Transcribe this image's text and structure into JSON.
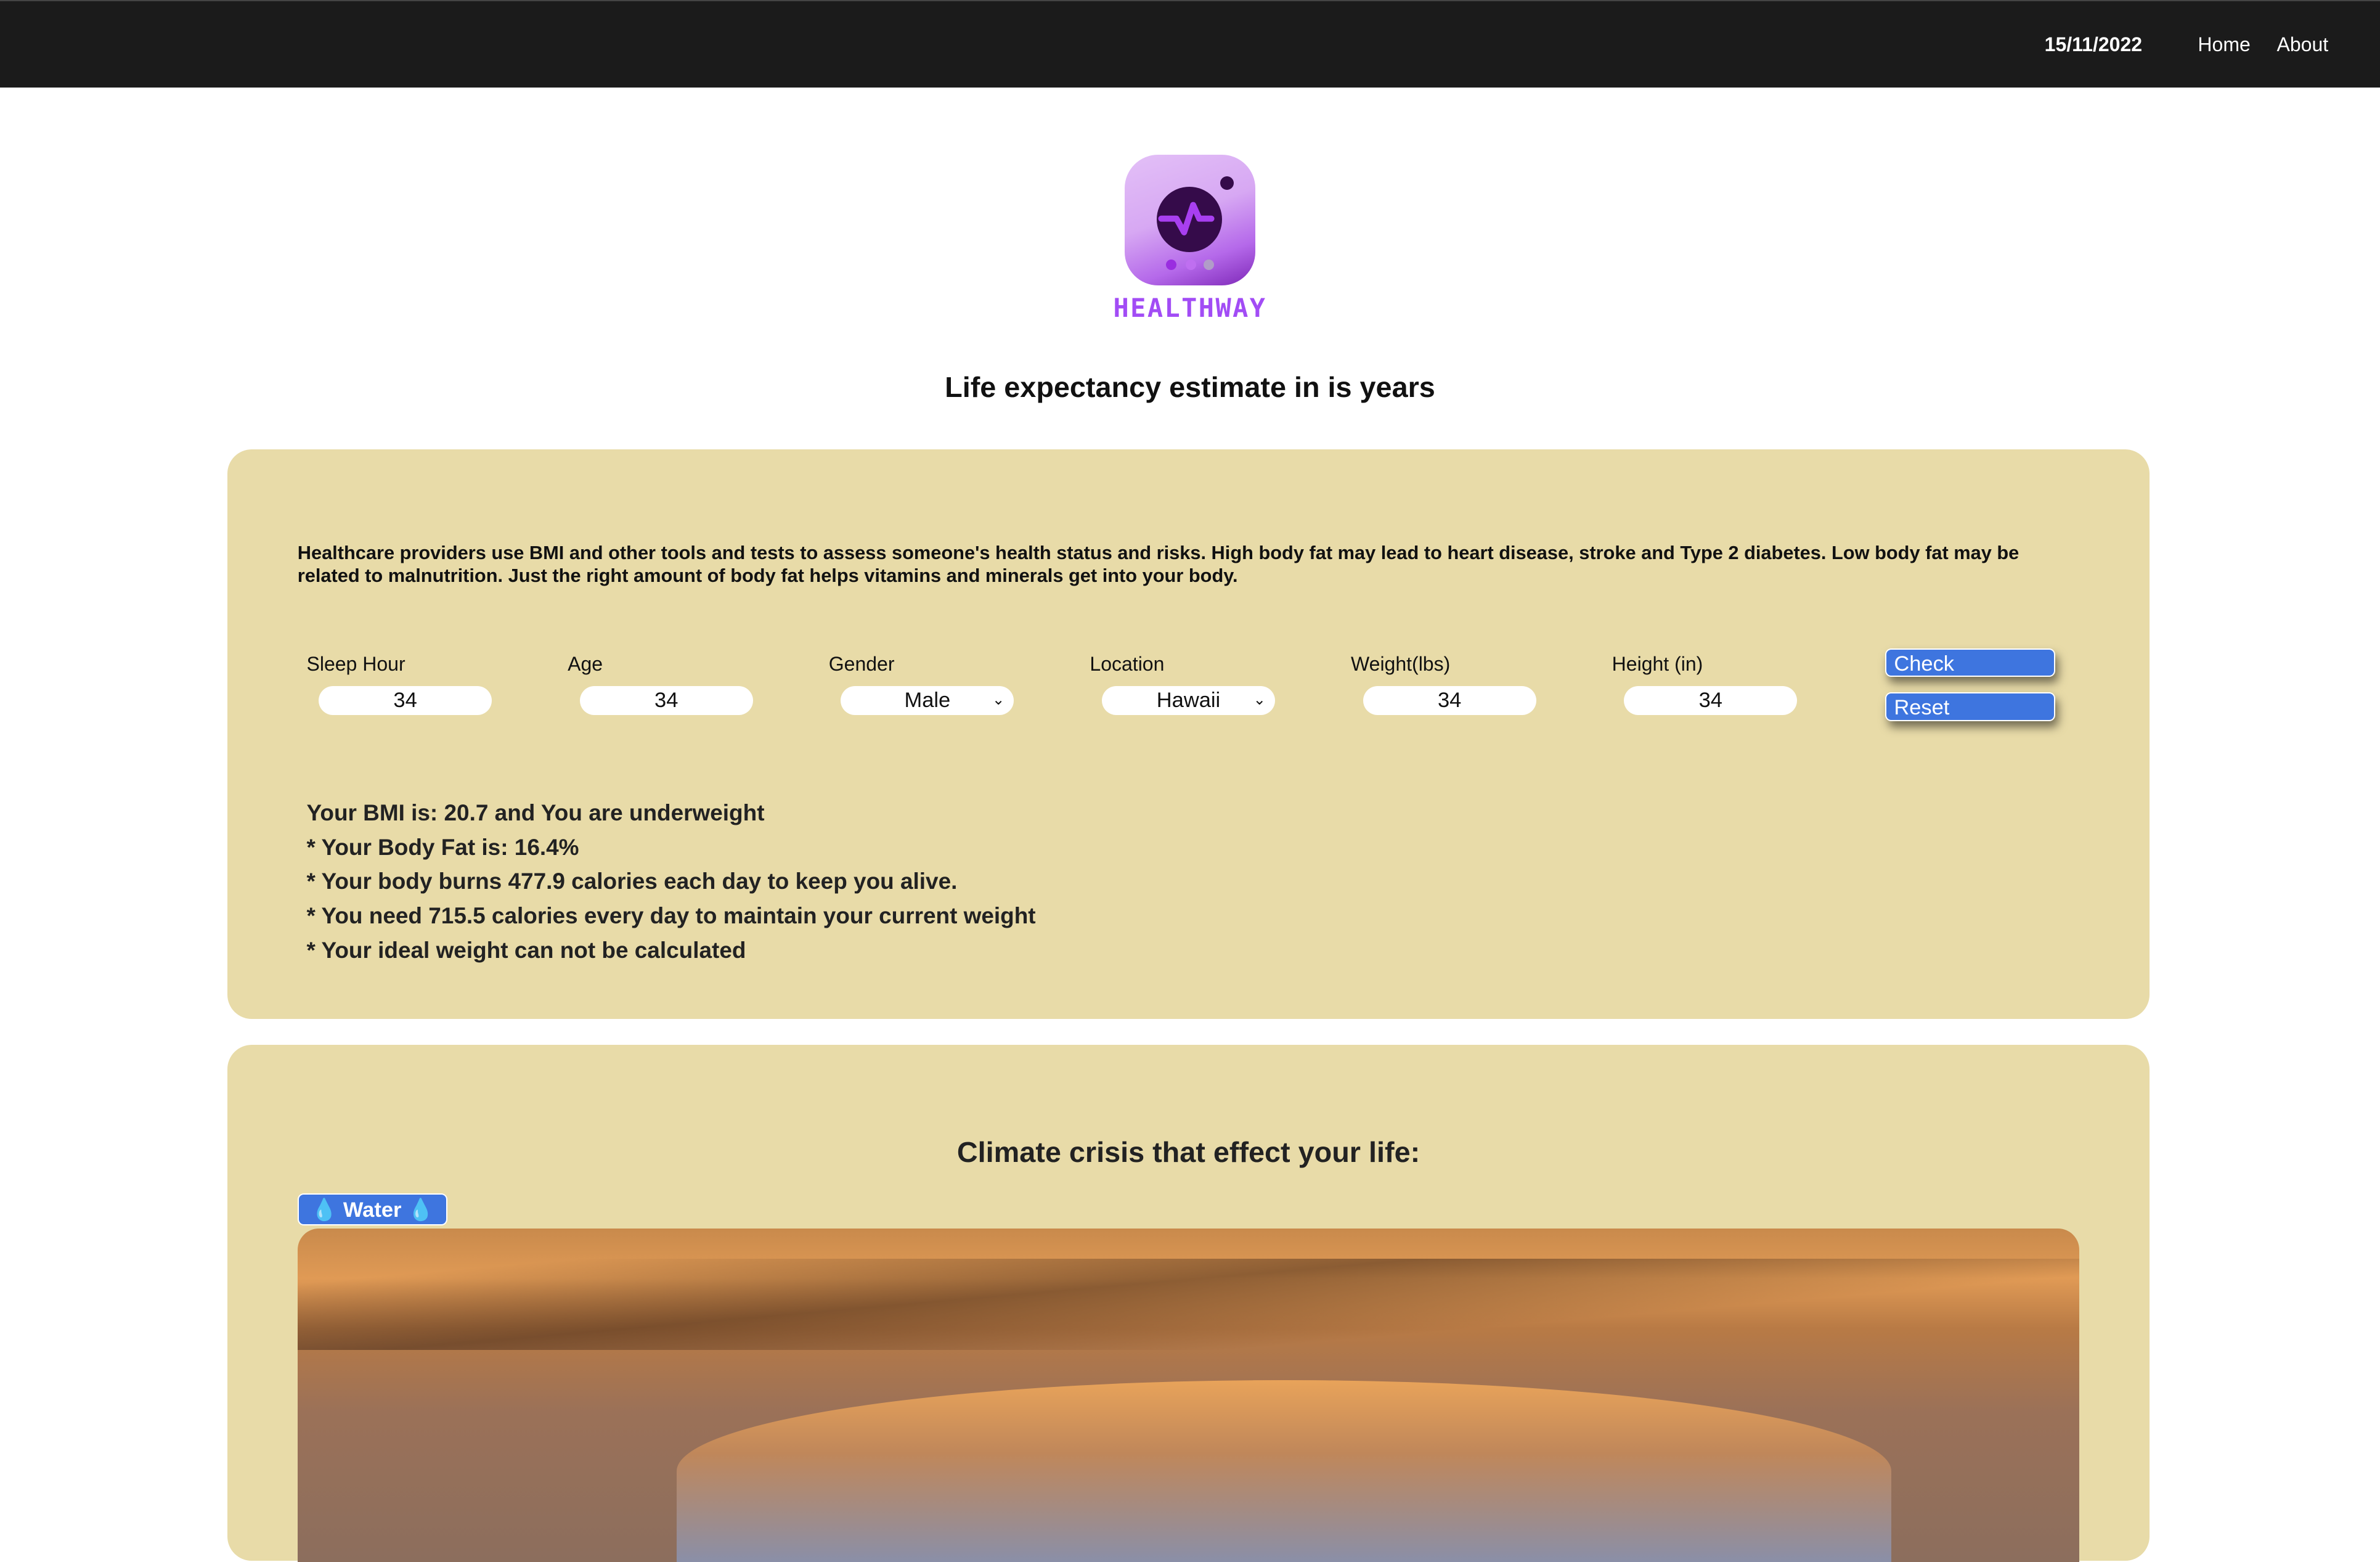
{
  "nav": {
    "date": "15/11/2022",
    "links": [
      "Home",
      "About"
    ]
  },
  "brand": {
    "name": "HEALTHWAY",
    "colors": {
      "purple": "#a24cf5",
      "dark": "#350b4a"
    }
  },
  "title": "Life expectancy estimate in is years",
  "form": {
    "intro": "Healthcare providers use BMI and other tools and tests to assess someone's health status and risks. High body fat may lead to heart disease, stroke and Type 2 diabetes. Low body fat may be related to malnutrition. Just the right amount of body fat helps vitamins and minerals get into your body.",
    "fields": [
      {
        "label": "Sleep Hour",
        "value": "34"
      },
      {
        "label": "Age",
        "value": "34"
      },
      {
        "label": "Gender",
        "value": "Male"
      },
      {
        "label": "Location",
        "value": "Hawaii"
      },
      {
        "label": "Weight(lbs)",
        "value": "34"
      },
      {
        "label": "Height (in)",
        "value": "34"
      }
    ],
    "check_label": "Check",
    "reset_label": "Reset",
    "results": [
      "Your BMI is: 20.7 and You are underweight",
      "* Your Body Fat is: 16.4%",
      "* Your body burns 477.9 calories each day to keep you alive.",
      "* You need 715.5 calories every day to maintain your current weight",
      "* Your ideal weight can not be calculated"
    ]
  },
  "climate": {
    "heading": "Climate crisis that effect your life:",
    "badge": "💧 Water 💧"
  },
  "colors": {
    "card": "#e8dba8",
    "button": "#3e75df",
    "navbar": "#1b1b1b"
  }
}
